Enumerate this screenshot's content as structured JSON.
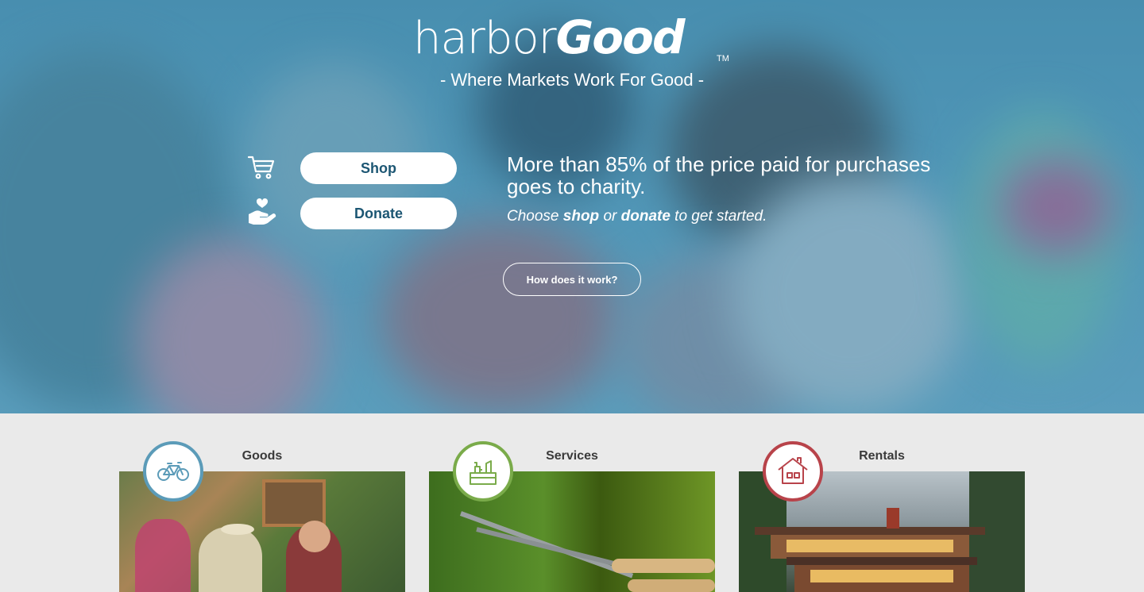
{
  "brand": {
    "name_light": "harbor",
    "name_bold": "Good",
    "trademark": "TM",
    "tagline": "- Where Markets Work For Good -"
  },
  "hero": {
    "shop_label": "Shop",
    "donate_label": "Donate",
    "headline": "More than 85% of the price paid for purchases goes to charity.",
    "sub_prefix": "Choose ",
    "sub_shop": "shop",
    "sub_mid": " or ",
    "sub_donate": "donate",
    "sub_suffix": " to get started.",
    "how_label": "How does it work?"
  },
  "categories": [
    {
      "label": "Goods",
      "icon": "bicycle-icon",
      "color": "#5b9bb8"
    },
    {
      "label": "Services",
      "icon": "tools-icon",
      "color": "#7aab4a"
    },
    {
      "label": "Rentals",
      "icon": "house-icon",
      "color": "#b8434a"
    }
  ]
}
